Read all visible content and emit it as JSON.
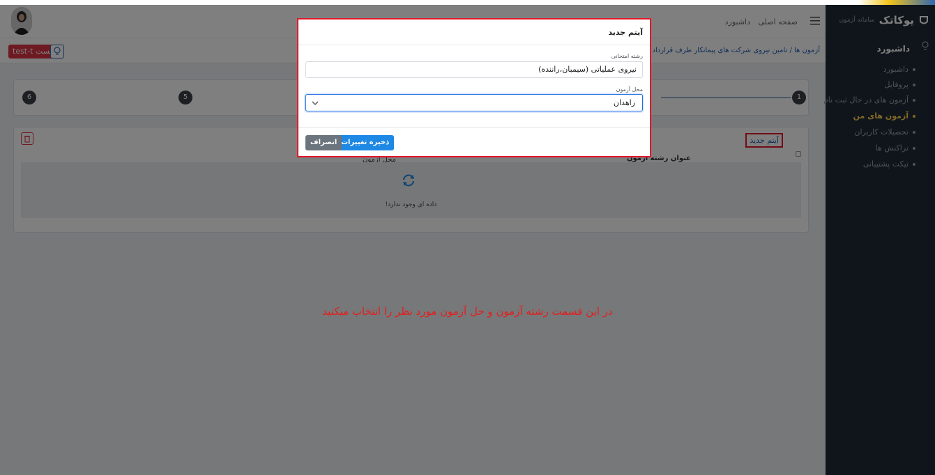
{
  "brand": {
    "name": "یوکاتک",
    "subtitle": "سامانه آزمون"
  },
  "navbar": {
    "home_link": "صفحه اصلی",
    "dashboard_link": "داشبورد"
  },
  "sidebar": {
    "menu_title": "داشبورد",
    "items": [
      {
        "label": "داشبورد",
        "active": false
      },
      {
        "label": "پروفایل",
        "active": false
      },
      {
        "label": "آزمون های در حال ثبت نام",
        "active": false
      },
      {
        "label": "آزمون های من",
        "active": true
      },
      {
        "label": "تحصیلات کاربران",
        "active": false
      },
      {
        "label": "تراکنش ها",
        "active": false
      },
      {
        "label": "تیکت پشتیبانی",
        "active": false
      }
    ]
  },
  "breadcrumb": {
    "text": "آزمون ها  /  تامین نیروی شرکت های پیمانکار طرف قرارداد با شرکت توزیع نیرو..."
  },
  "user": {
    "badge": "test-t تست"
  },
  "stepper": {
    "steps": [
      "1",
      "5",
      "6"
    ]
  },
  "table": {
    "new_item_button": "آیتم جدید",
    "col_title": "عنوان رشته آزمون",
    "col_second": "محل آزمون",
    "empty_text": "داده ای وجود ندارد!"
  },
  "modal": {
    "title": "آیتم جدید",
    "field1_label": "رشته امتحانی",
    "field1_value": "نیروی عملیاتی (سیمبان،راننده)",
    "field2_label": "محل آزمون",
    "field2_value": "زاهدان",
    "save_label": "ذخیره تغییرات",
    "cancel_label": "انصراف"
  },
  "annotation": "در این قسمت رشته آزمون و حل آزمون مورد نظر را انتخاب میکنید",
  "colors": {
    "sidebar_bg": "#1f2a36",
    "accent": "#1e88e5",
    "danger": "#e2182b",
    "active_menu": "#ffd34d"
  }
}
